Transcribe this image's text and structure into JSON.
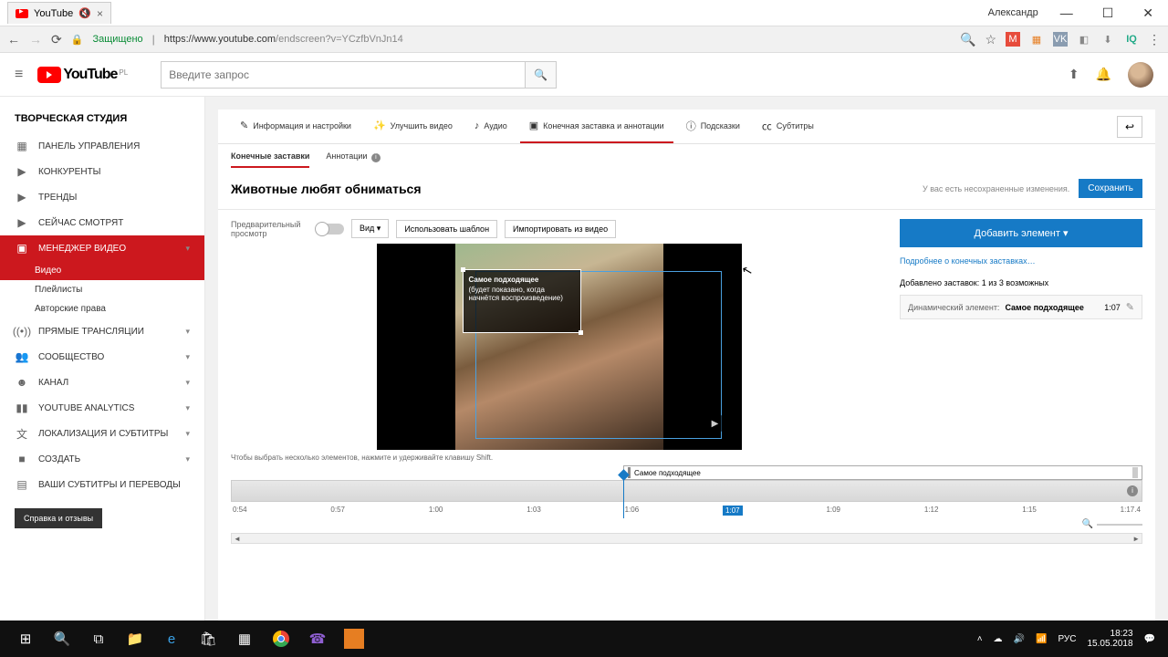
{
  "window": {
    "tab_title": "YouTube",
    "user": "Александр"
  },
  "address": {
    "secure": "Защищено",
    "host": "https://www.youtube.com",
    "path": "/endscreen?v=YCzfbVnJn14"
  },
  "masthead": {
    "brand": "YouTube",
    "region": "PL",
    "search_placeholder": "Введите запрос"
  },
  "sidebar": {
    "title": "ТВОРЧЕСКАЯ СТУДИЯ",
    "dashboard": "ПАНЕЛЬ УПРАВЛЕНИЯ",
    "competitors": "КОНКУРЕНТЫ",
    "trends": "ТРЕНДЫ",
    "watch_now": "СЕЙЧАС СМОТРЯТ",
    "video_manager": "МЕНЕДЖЕР ВИДЕО",
    "videos": "Видео",
    "playlists": "Плейлисты",
    "copyright": "Авторские права",
    "live": "ПРЯМЫЕ ТРАНСЛЯЦИИ",
    "community": "СООБЩЕСТВО",
    "channel": "КАНАЛ",
    "analytics": "YOUTUBE ANALYTICS",
    "localization": "ЛОКАЛИЗАЦИЯ И СУБТИТРЫ",
    "create": "СОЗДАТЬ",
    "contrib": "ВАШИ СУБТИТРЫ И ПЕРЕВОДЫ",
    "help": "Справка и отзывы"
  },
  "tabs": {
    "info": "Информация и настройки",
    "enhance": "Улучшить видео",
    "audio": "Аудио",
    "endscreen": "Конечная заставка и аннотации",
    "cards": "Подсказки",
    "subtitles": "Субтитры"
  },
  "subtabs": {
    "endscreens": "Конечные заставки",
    "annotations": "Аннотации"
  },
  "header": {
    "title": "Животные любят обниматься",
    "unsaved": "У вас есть несохраненные изменения.",
    "save": "Сохранить"
  },
  "controls": {
    "preview": "Предварительный просмотр",
    "view": "Вид ▾",
    "template": "Использовать шаблон",
    "import": "Импортировать из видео"
  },
  "overlay": {
    "title": "Самое подходящее",
    "sub": "(будет показано, когда начнётся воспроизведение)"
  },
  "hint": "Чтобы выбрать несколько элементов, нажмите и удерживайте клавишу Shift.",
  "right": {
    "add": "Добавить элемент ▾",
    "more": "Подробнее о конечных заставках…",
    "added": "Добавлено заставок: 1 из 3 возможных",
    "elem_type": "Динамический элемент:",
    "elem_name": "Самое подходящее",
    "elem_time": "1:07"
  },
  "timeline": {
    "elem_label": "Самое подходящее",
    "ticks": [
      "0:54",
      "0:57",
      "1:00",
      "1:03",
      "1:06",
      "1:07",
      "1:09",
      "1:12",
      "1:15",
      "1:17.4"
    ]
  },
  "tray": {
    "lang": "РУС",
    "time": "18:23",
    "date": "15.05.2018"
  }
}
